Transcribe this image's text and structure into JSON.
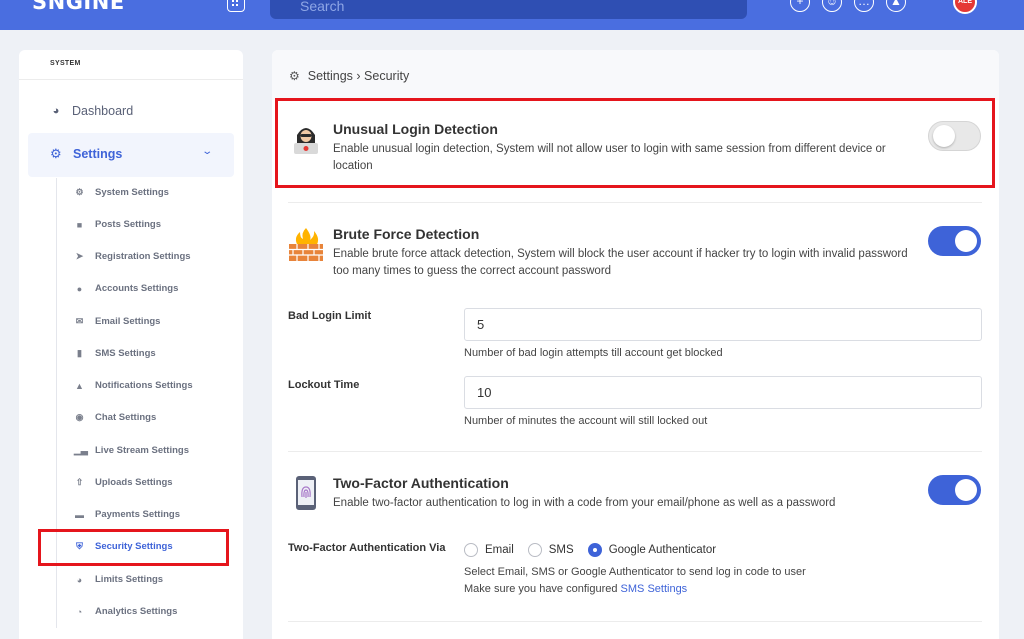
{
  "header": {
    "logo": "SNGINE",
    "search_placeholder": "Search",
    "avatar_text": "ALE"
  },
  "sidebar": {
    "heading": "SYSTEM",
    "dashboard": "Dashboard",
    "settings": "Settings",
    "items": [
      {
        "label": "System Settings",
        "icon": "gears-icon"
      },
      {
        "label": "Posts Settings",
        "icon": "comment-icon"
      },
      {
        "label": "Registration Settings",
        "icon": "sign-in-icon"
      },
      {
        "label": "Accounts Settings",
        "icon": "users-icon"
      },
      {
        "label": "Email Settings",
        "icon": "envelope-icon"
      },
      {
        "label": "SMS Settings",
        "icon": "mobile-icon"
      },
      {
        "label": "Notifications Settings",
        "icon": "bell-icon"
      },
      {
        "label": "Chat Settings",
        "icon": "comments-icon"
      },
      {
        "label": "Live Stream Settings",
        "icon": "signal-icon"
      },
      {
        "label": "Uploads Settings",
        "icon": "upload-icon"
      },
      {
        "label": "Payments Settings",
        "icon": "credit-card-icon"
      },
      {
        "label": "Security Settings",
        "icon": "shield-icon"
      },
      {
        "label": "Limits Settings",
        "icon": "gauge-icon"
      },
      {
        "label": "Analytics Settings",
        "icon": "pie-chart-icon"
      }
    ],
    "active_item": "Security Settings"
  },
  "breadcrumb": "Settings › Security",
  "features": {
    "unusual_login": {
      "title": "Unusual Login Detection",
      "description": "Enable unusual login detection, System will not allow user to login with same session from different device or location",
      "enabled": false
    },
    "brute_force": {
      "title": "Brute Force Detection",
      "description": "Enable brute force attack detection, System will block the user account if hacker try to login with invalid password too many times to guess the correct account password",
      "enabled": true
    },
    "two_factor": {
      "title": "Two-Factor Authentication",
      "description": "Enable two-factor authentication to log in with a code from your email/phone as well as a password",
      "enabled": true
    }
  },
  "fields": {
    "bad_login_limit": {
      "label": "Bad Login Limit",
      "value": "5",
      "help": "Number of bad login attempts till account get blocked"
    },
    "lockout_time": {
      "label": "Lockout Time",
      "value": "10",
      "help": "Number of minutes the account will still locked out"
    },
    "two_factor_via": {
      "label": "Two-Factor Authentication Via",
      "options": [
        "Email",
        "SMS",
        "Google Authenticator"
      ],
      "selected": "Google Authenticator",
      "help_line1": "Select Email, SMS or Google Authenticator to send log in code to user",
      "help_line2_prefix": "Make sure you have configured ",
      "help_link": "SMS Settings"
    }
  },
  "colors": {
    "accent": "#3e63d8",
    "topbar": "#4a6ee0",
    "highlight_border": "#e5151c"
  }
}
